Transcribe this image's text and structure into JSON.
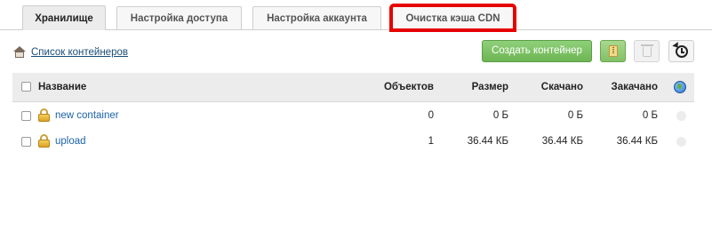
{
  "tabs": [
    {
      "label": "Хранилище",
      "active": true
    },
    {
      "label": "Настройка доступа",
      "active": false
    },
    {
      "label": "Настройка аккаунта",
      "active": false
    },
    {
      "label": "Очистка кэша CDN",
      "active": false,
      "highlighted": true
    }
  ],
  "toolbar": {
    "crumb_icon": "home-icon",
    "crumb_label": "Список контейнеров",
    "create_label": "Создать контейнер",
    "icons": [
      "archive-icon",
      "trash-icon",
      "history-icon"
    ]
  },
  "table": {
    "headers": {
      "name": "Название",
      "objects": "Объектов",
      "size": "Размер",
      "downloaded": "Скачано",
      "uploaded": "Закачано",
      "globe_icon": "globe-icon"
    },
    "rows": [
      {
        "name": "new container",
        "objects": "0",
        "size": "0 Б",
        "downloaded": "0 Б",
        "uploaded": "0 Б"
      },
      {
        "name": "upload",
        "objects": "1",
        "size": "36.44 КБ",
        "downloaded": "36.44 КБ",
        "uploaded": "36.44 КБ"
      }
    ]
  },
  "colors": {
    "highlight": "#e60000",
    "create_button": "#78bc5d",
    "link": "#1a63a8"
  }
}
